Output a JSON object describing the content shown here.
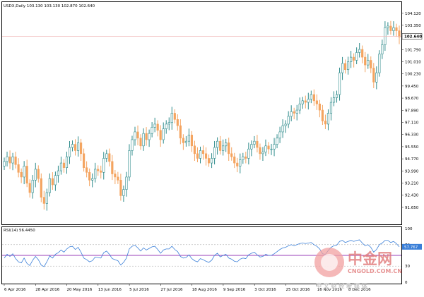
{
  "header": {
    "main": "USDX,Daily  103.130 103.130 102.870 102.640",
    "rsi": "RSI(14) 56.4450"
  },
  "price_tag": "102.640",
  "rsi_tag": "57.767",
  "colors": {
    "bull": "#2e8b8b",
    "bear": "#f4a460",
    "rsi": "#3a7fd8",
    "rsi_mid": "#9a3fb8"
  },
  "watermark": {
    "brand": "中金网",
    "site": "CNGOLD.COM.CN",
    "slogan": "中 文 财 经 新 媒 体"
  },
  "chart_data": {
    "type": "candlestick",
    "ylim": [
      90.65,
      104.25
    ],
    "y_ticks": [
      "104.120",
      "103.350",
      "102.640",
      "101.790",
      "101.010",
      "100.230",
      "99.450",
      "98.670",
      "97.890",
      "97.110",
      "96.330",
      "95.550",
      "94.770",
      "93.990",
      "93.210",
      "92.430",
      "91.650"
    ],
    "y_tick_values": [
      104.12,
      103.35,
      102.64,
      101.79,
      101.01,
      100.23,
      99.45,
      98.67,
      97.89,
      97.11,
      96.33,
      95.55,
      94.77,
      93.99,
      93.21,
      92.43,
      91.65
    ],
    "x_ticks": [
      "6 Apr 2016",
      "28 Apr 2016",
      "20 May 2016",
      "13 Jun 2016",
      "5 Jul 2016",
      "27 Jul 2016",
      "18 Aug 2016",
      "9 Sep 2016",
      "3 Oct 2016",
      "25 Oct 2016",
      "16 Nov 2016",
      "8 Dec 2016"
    ],
    "last_price": 102.64,
    "closes": [
      94.6,
      94.9,
      94.5,
      94.9,
      94.4,
      93.9,
      93.6,
      94.3,
      93.2,
      92.6,
      93.4,
      94.1,
      93.5,
      92.3,
      91.9,
      92.6,
      93.5,
      93.1,
      93.7,
      94.0,
      94.5,
      94.2,
      94.9,
      95.5,
      95.7,
      95.3,
      95.8,
      95.1,
      94.2,
      93.9,
      93.4,
      93.5,
      94.1,
      94.0,
      93.9,
      94.8,
      95.1,
      94.6,
      93.8,
      93.6,
      93.4,
      92.4,
      92.8,
      93.6,
      95.3,
      96.0,
      96.5,
      96.1,
      95.6,
      96.4,
      96.0,
      96.4,
      96.8,
      97.0,
      96.6,
      96.0,
      96.7,
      97.0,
      97.1,
      97.7,
      97.3,
      96.9,
      96.1,
      95.8,
      95.9,
      96.3,
      95.6,
      95.1,
      94.8,
      95.3,
      95.1,
      94.8,
      94.5,
      94.8,
      95.5,
      95.9,
      95.3,
      95.6,
      95.8,
      95.1,
      94.9,
      94.5,
      94.3,
      94.7,
      94.9,
      94.8,
      95.4,
      95.7,
      95.9,
      95.5,
      95.1,
      95.2,
      95.6,
      95.4,
      95.4,
      95.7,
      96.1,
      96.5,
      96.9,
      97.0,
      97.5,
      97.8,
      97.7,
      97.9,
      98.3,
      98.5,
      98.4,
      98.6,
      98.9,
      98.5,
      98.3,
      97.9,
      97.2,
      97.0,
      97.7,
      98.4,
      98.7,
      98.9,
      100.3,
      100.9,
      100.5,
      101.0,
      101.3,
      101.1,
      101.6,
      101.8,
      101.3,
      100.8,
      101.1,
      100.6,
      99.7,
      100.3,
      101.5,
      102.1,
      103.2,
      103.3,
      103.0,
      103.2,
      103.0,
      102.6
    ],
    "opens": [
      94.3,
      94.6,
      94.9,
      94.5,
      94.9,
      94.4,
      93.9,
      93.6,
      94.3,
      93.2,
      92.6,
      93.4,
      94.1,
      93.5,
      92.3,
      91.9,
      92.6,
      93.5,
      93.1,
      93.7,
      94.0,
      94.5,
      94.2,
      94.9,
      95.5,
      95.7,
      95.3,
      95.8,
      95.1,
      94.2,
      93.9,
      93.4,
      93.5,
      94.1,
      94.0,
      93.9,
      94.8,
      95.1,
      94.6,
      93.8,
      93.6,
      93.4,
      92.4,
      92.8,
      93.6,
      95.3,
      96.0,
      96.5,
      96.1,
      95.6,
      96.4,
      96.0,
      96.4,
      96.8,
      97.0,
      96.6,
      96.0,
      96.7,
      97.0,
      97.1,
      97.7,
      97.3,
      96.9,
      96.1,
      95.8,
      95.9,
      96.3,
      95.6,
      95.1,
      94.8,
      95.3,
      95.1,
      94.8,
      94.5,
      94.8,
      95.5,
      95.9,
      95.3,
      95.6,
      95.8,
      95.1,
      94.9,
      94.5,
      94.3,
      94.7,
      94.9,
      94.8,
      95.4,
      95.7,
      95.9,
      95.5,
      95.1,
      95.2,
      95.6,
      95.4,
      95.4,
      95.7,
      96.1,
      96.5,
      96.9,
      97.0,
      97.5,
      97.8,
      97.7,
      97.9,
      98.3,
      98.5,
      98.4,
      98.6,
      98.9,
      98.5,
      98.3,
      97.9,
      97.2,
      97.0,
      97.7,
      98.4,
      98.7,
      98.9,
      100.3,
      100.9,
      100.5,
      101.0,
      101.3,
      101.1,
      101.6,
      101.8,
      101.3,
      100.8,
      101.1,
      100.6,
      99.7,
      100.3,
      101.5,
      102.1,
      103.2,
      103.3,
      103.0,
      103.2,
      103.0
    ],
    "rsi": {
      "name": "RSI(14)",
      "ylim": [
        0,
        100
      ],
      "y_ticks": [
        "100",
        "70",
        "30",
        "0"
      ],
      "levels": [
        70,
        30,
        50
      ],
      "values": [
        45,
        52,
        48,
        53,
        44,
        38,
        36,
        45,
        35,
        31,
        41,
        48,
        42,
        32,
        29,
        38,
        49,
        45,
        52,
        55,
        60,
        56,
        62,
        66,
        67,
        61,
        65,
        56,
        45,
        42,
        38,
        40,
        47,
        46,
        45,
        55,
        58,
        52,
        44,
        42,
        40,
        32,
        37,
        45,
        62,
        67,
        69,
        64,
        58,
        64,
        60,
        63,
        66,
        67,
        61,
        54,
        60,
        62,
        62,
        67,
        61,
        57,
        48,
        45,
        46,
        51,
        44,
        40,
        38,
        44,
        42,
        39,
        37,
        41,
        50,
        54,
        47,
        50,
        52,
        45,
        43,
        39,
        38,
        43,
        45,
        44,
        51,
        54,
        56,
        51,
        47,
        48,
        52,
        50,
        50,
        53,
        57,
        61,
        64,
        65,
        68,
        70,
        68,
        70,
        72,
        73,
        72,
        73,
        74,
        70,
        67,
        62,
        53,
        52,
        59,
        65,
        68,
        69,
        76,
        78,
        74,
        76,
        78,
        76,
        78,
        79,
        73,
        68,
        70,
        65,
        56,
        61,
        70,
        73,
        78,
        78,
        74,
        76,
        72,
        66
      ]
    }
  }
}
